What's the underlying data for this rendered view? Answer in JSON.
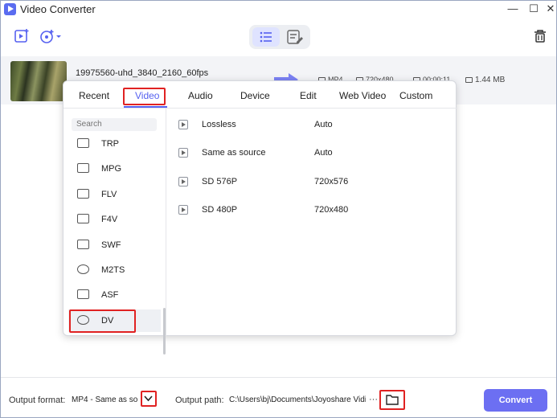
{
  "window": {
    "title": "Video Converter"
  },
  "titlebar": {
    "minimize": "—",
    "maximize": "☐",
    "close": "✕"
  },
  "toolbar": {
    "add_file_icon": "add-video-icon",
    "add_dvd_icon": "add-disc-icon",
    "view_list_icon": "list-view-icon",
    "view_edit_icon": "edit-list-icon",
    "delete_icon": "trash-icon"
  },
  "file": {
    "name": "19975560-uhd_3840_2160_60fps",
    "format": "MP4",
    "resolution": "720x480",
    "duration": "00:00:11",
    "size": "1.44 MB"
  },
  "popup": {
    "tabs": [
      "Recent",
      "Video",
      "Audio",
      "Device",
      "Edit",
      "Web Video",
      "Custom"
    ],
    "active_tab": "Video",
    "search_placeholder": "Search",
    "formats": [
      "TRP",
      "MPG",
      "FLV",
      "F4V",
      "SWF",
      "M2TS",
      "ASF",
      "DV"
    ],
    "selected_format": "DV",
    "presets": [
      {
        "name": "Lossless",
        "resolution": "Auto"
      },
      {
        "name": "Same as source",
        "resolution": "Auto"
      },
      {
        "name": "SD 576P",
        "resolution": "720x576"
      },
      {
        "name": "SD 480P",
        "resolution": "720x480"
      }
    ]
  },
  "bottom": {
    "output_format_label": "Output format:",
    "output_format_value": "MP4 - Same as so...",
    "output_path_label": "Output path:",
    "output_path_value": "C:\\Users\\bj\\Documents\\Joyoshare VidiK",
    "more": "···",
    "convert_label": "Convert"
  },
  "colors": {
    "accent": "#5661f0",
    "highlight": "#e02222",
    "convert": "#6c6ff2"
  }
}
